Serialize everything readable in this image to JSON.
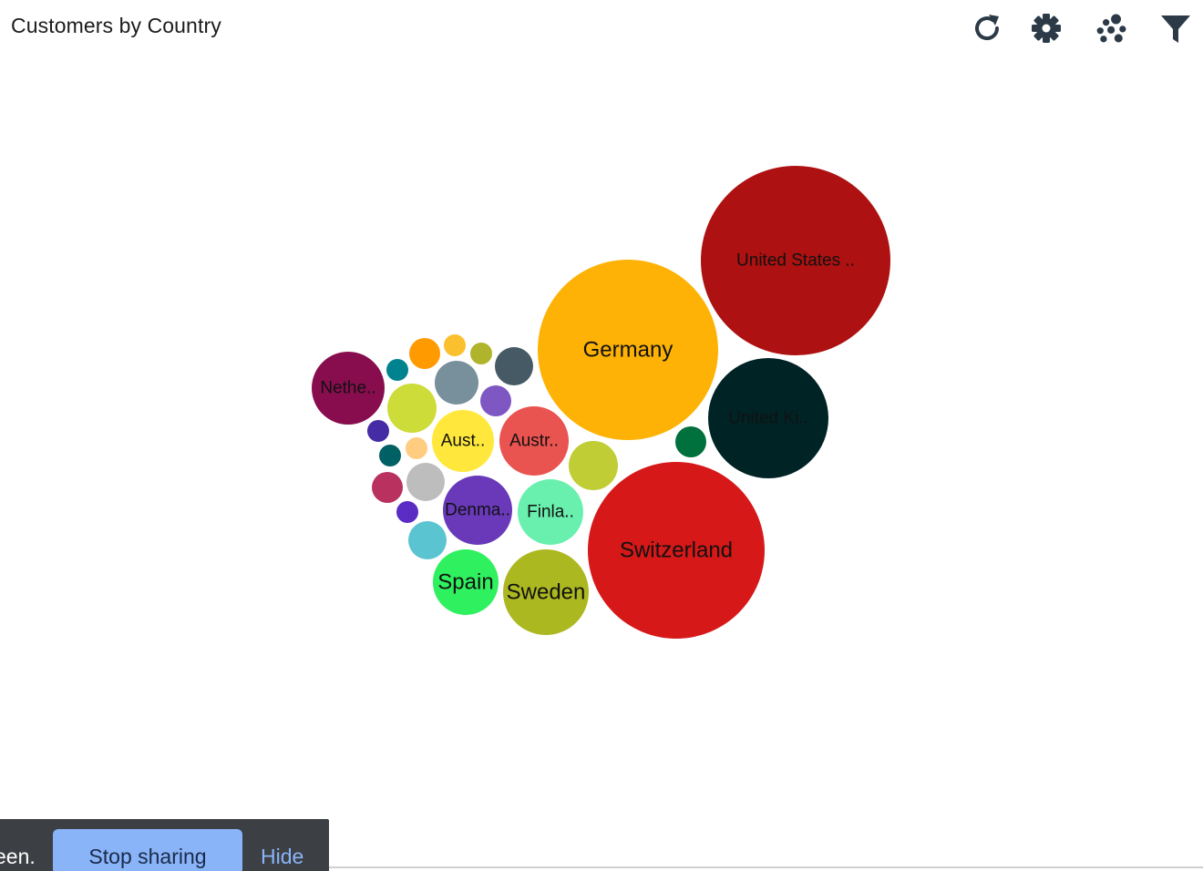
{
  "header": {
    "title": "Customers by Country"
  },
  "toolbar": {
    "icons": [
      "refresh-icon",
      "gear-icon",
      "bubbles-icon",
      "filter-icon"
    ]
  },
  "chart_data": {
    "type": "bubble",
    "title": "Customers by Country",
    "bubbles": [
      {
        "label": "United States ..",
        "color": "#ad1111",
        "value": 13
      },
      {
        "label": "Germany",
        "color": "#fdb205",
        "value": 11
      },
      {
        "label": "Switzerland",
        "color": "#d61818",
        "value": 11
      },
      {
        "label": "United Ki..",
        "color": "#002326",
        "value": 5
      },
      {
        "label": "Austr..",
        "color": "#e95350",
        "value": 2
      },
      {
        "label": "Aust..",
        "color": "#ffe83b",
        "value": 1.5
      },
      {
        "label": "Nethe..",
        "color": "#870d4e",
        "value": 1.8
      },
      {
        "label": "Denma..",
        "color": "#6939ba",
        "value": 1.7
      },
      {
        "label": "Finla..",
        "color": "#69f0ae",
        "value": 1.5
      },
      {
        "label": "Spain",
        "color": "#2ff05f",
        "value": 1.5
      },
      {
        "label": "Sweden",
        "color": "#acb820",
        "value": 2.5
      },
      {
        "label": "",
        "color": "#c0cd35",
        "value": 0.9
      },
      {
        "label": "",
        "color": "#cddc39",
        "value": 0.8
      },
      {
        "label": "",
        "color": "#78909c",
        "value": 0.65
      },
      {
        "label": "",
        "color": "#455a64",
        "value": 0.5
      },
      {
        "label": "",
        "color": "#7e57c2",
        "value": 0.3
      },
      {
        "label": "",
        "color": "#ff9a00",
        "value": 0.3
      },
      {
        "label": "",
        "color": "#fbc02d",
        "value": 0.2
      },
      {
        "label": "",
        "color": "#afb42b",
        "value": 0.2
      },
      {
        "label": "",
        "color": "#00838f",
        "value": 0.2
      },
      {
        "label": "",
        "color": "#bdbdbd",
        "value": 0.5
      },
      {
        "label": "",
        "color": "#5bc4d1",
        "value": 0.5
      },
      {
        "label": "",
        "color": "#b9315e",
        "value": 0.35
      },
      {
        "label": "",
        "color": "#00703c",
        "value": 0.3
      },
      {
        "label": "",
        "color": "#452ba4",
        "value": 0.2
      },
      {
        "label": "",
        "color": "#006064",
        "value": 0.2
      },
      {
        "label": "",
        "color": "#ffcc80",
        "value": 0.2
      },
      {
        "label": "",
        "color": "#5b2cc4",
        "value": 0.2
      }
    ]
  },
  "share_bar": {
    "message": "een.",
    "stop_label": "Stop sharing",
    "hide_label": "Hide"
  }
}
